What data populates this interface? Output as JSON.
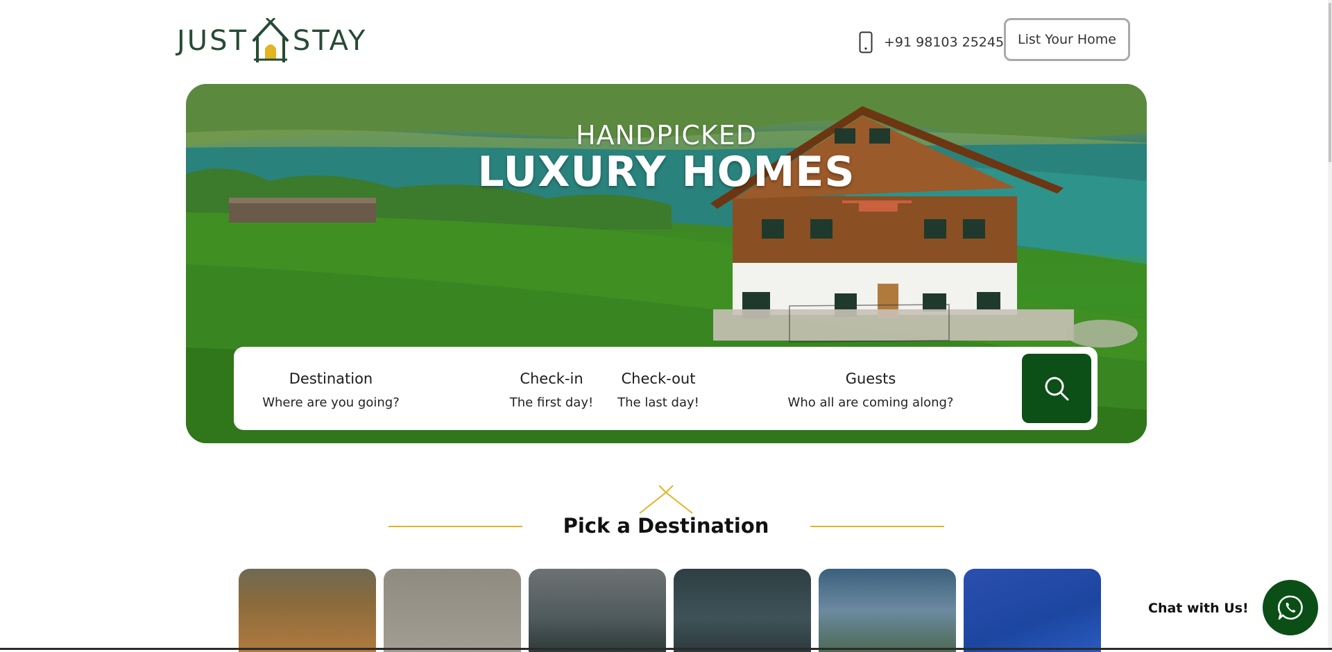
{
  "brand": {
    "left": "JUST",
    "right": "STAY",
    "color": "#264b33",
    "accent": "#e3b424"
  },
  "header": {
    "phone_icon": "phone-icon",
    "phone": "+91 98103 25245",
    "cta_label": "List Your Home"
  },
  "hero": {
    "subtitle": "HANDPICKED",
    "title": "LUXURY HOMES",
    "search": {
      "destination_label": "Destination",
      "destination_placeholder": "Where are you going?",
      "checkin_label": "Check-in",
      "checkin_placeholder": "The first day!",
      "checkout_label": "Check-out",
      "checkout_placeholder": "The last day!",
      "guests_label": "Guests",
      "guests_placeholder": "Who all are coming along?",
      "button_icon": "search-icon",
      "button_color": "#0c4f17"
    }
  },
  "section": {
    "title": "Pick a Destination"
  },
  "destination_cards": [
    {
      "color": "#7b5a37"
    },
    {
      "color": "#9a958a"
    },
    {
      "color": "#5d6a6e"
    },
    {
      "color": "#3f5256"
    },
    {
      "color": "#4e7087"
    },
    {
      "color": "#1f4fa8"
    }
  ],
  "chat": {
    "label": "Chat with Us!",
    "icon": "whatsapp-icon",
    "color": "#0b4f16"
  }
}
